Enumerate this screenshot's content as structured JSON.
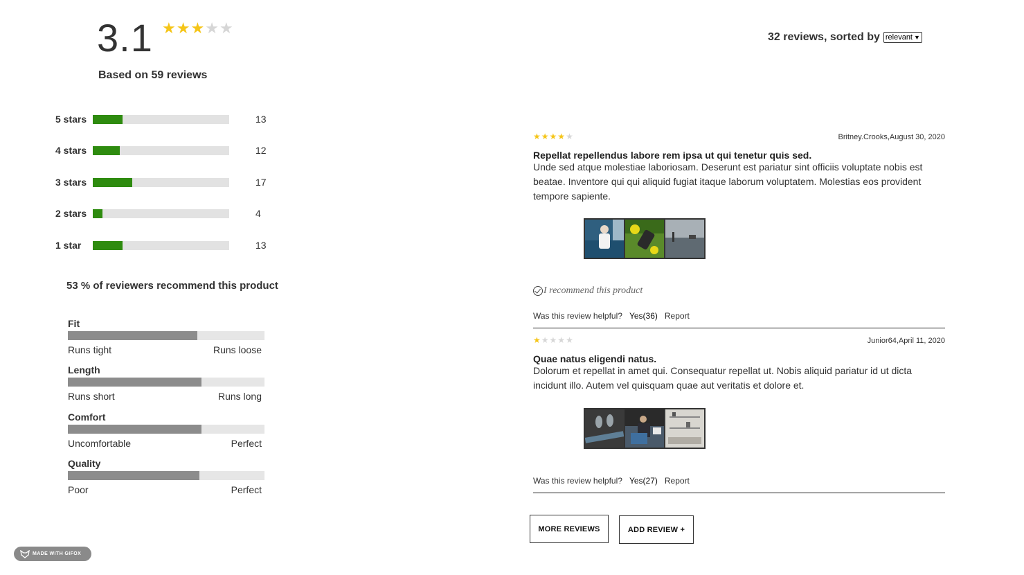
{
  "summary": {
    "average": "3.1",
    "average_stars": 3,
    "max_stars": 5,
    "based_on": "Based on 59 reviews",
    "distribution": [
      {
        "label": "5 stars",
        "count": "13",
        "fill": 0.22
      },
      {
        "label": "4 stars",
        "count": "12",
        "fill": 0.2
      },
      {
        "label": "3 stars",
        "count": "17",
        "fill": 0.29
      },
      {
        "label": "2 stars",
        "count": "4",
        "fill": 0.07
      },
      {
        "label": "1 star",
        "count": "13",
        "fill": 0.22
      }
    ],
    "recommend_text": "53 % of reviewers recommend this product",
    "attributes": [
      {
        "title": "Fit",
        "low": "Runs tight",
        "high": "Runs loose",
        "fill": 0.66
      },
      {
        "title": "Length",
        "low": "Runs short",
        "high": "Runs long",
        "fill": 0.68
      },
      {
        "title": "Comfort",
        "low": "Uncomfortable",
        "high": "Perfect",
        "fill": 0.68
      },
      {
        "title": "Quality",
        "low": "Poor",
        "high": "Perfect",
        "fill": 0.67
      }
    ]
  },
  "sort": {
    "label": "32 reviews, sorted by",
    "selected": "relevant"
  },
  "reviews": [
    {
      "stars": 4,
      "author_date": "Britney.Crooks,August 30, 2020",
      "title": "Repellat repellendus labore rem ipsa ut qui tenetur quis sed.",
      "body": "Unde sed atque molestiae laboriosam. Deserunt est pariatur sint officiis voluptate nobis est beatae. Inventore qui qui aliquid fugiat itaque laborum voluptatem. Molestias eos provident tempore sapiente.",
      "recommend": "I recommend this product",
      "helpful_label": "Was this review helpful?",
      "yes_label": "Yes",
      "yes_count": "(36)",
      "report_label": "Report",
      "thumb_colors": [
        "#2f5f7f",
        "#5a8a2a",
        "#7f8a92"
      ]
    },
    {
      "stars": 1,
      "author_date": "Junior64,April 11, 2020",
      "title": "Quae natus eligendi natus.",
      "body": "Dolorum et repellat in amet qui. Consequatur repellat ut. Nobis aliquid pariatur id ut dicta incidunt illo. Autem vel quisquam quae aut veritatis et dolore et.",
      "helpful_label": "Was this review helpful?",
      "yes_label": "Yes",
      "yes_count": "(27)",
      "report_label": "Report",
      "thumb_colors": [
        "#3a3a3a",
        "#4a5a6a",
        "#d8d6d0"
      ]
    }
  ],
  "buttons": {
    "more_reviews": "MORE REVIEWS",
    "add_review": "ADD REVIEW +"
  },
  "badge": {
    "text": "MADE WITH GIFOX"
  },
  "colors": {
    "star_on": "#f5c518",
    "star_off": "#d6d6d6",
    "dist_fill": "#2e8b0f",
    "attr_fill": "#8c8c8c"
  }
}
